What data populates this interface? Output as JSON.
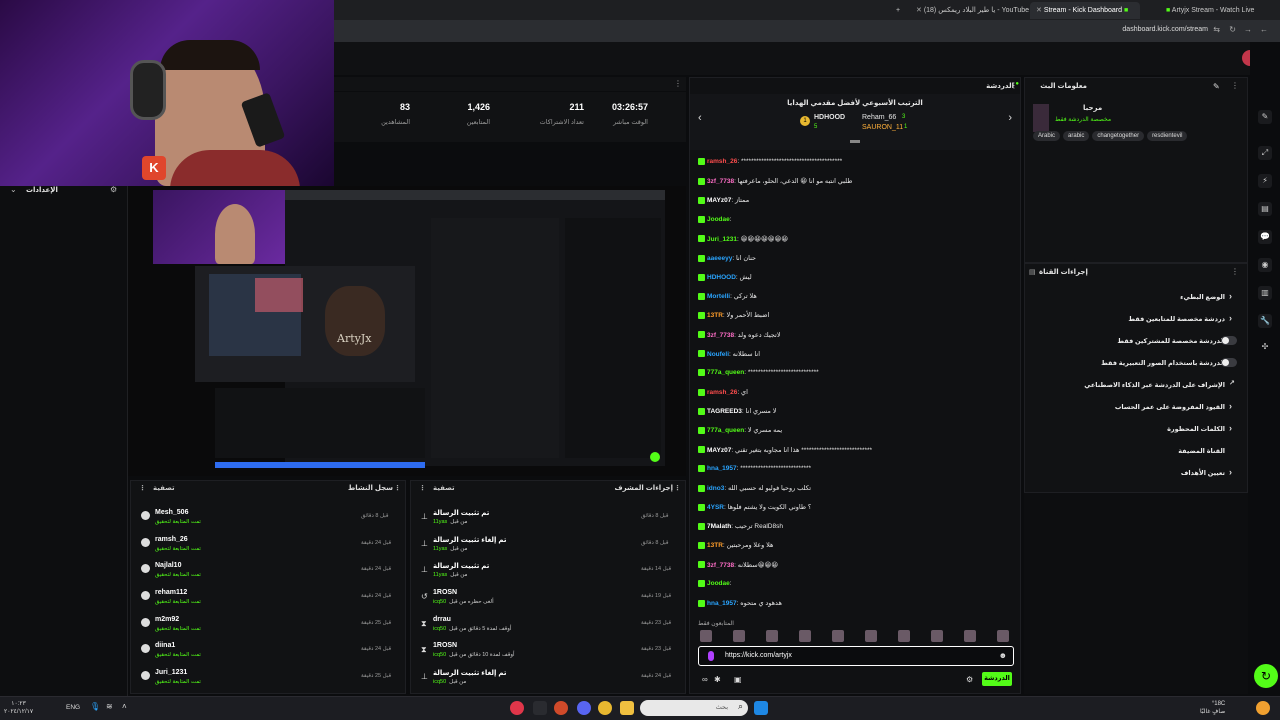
{
  "browser": {
    "tabs": [
      {
        "label": "Artyjx Stream - Watch Live"
      },
      {
        "label": "Stream - Kick Dashboard"
      },
      {
        "label": "(18) يا طير البلاد ريمكس - YouTube"
      }
    ],
    "url": "dashboard.kick.com/stream"
  },
  "left": {
    "title": "الإعدادات"
  },
  "webcam": {
    "logo": "K"
  },
  "stats": [
    {
      "value": "03:26:57",
      "label": "الوقت مباشر"
    },
    {
      "value": "211",
      "label": "تعداد الاشتراكات"
    },
    {
      "value": "1,426",
      "label": "المتابعين"
    },
    {
      "value": "83",
      "label": "المشاهدين"
    }
  ],
  "activity": {
    "title": "سجل النشاط",
    "filter": "تصفية",
    "rows": [
      {
        "name": "Mesh_506",
        "sub": "تمت المتابعة لتحقيق",
        "time": "قبل 8 دقائق"
      },
      {
        "name": "ramsh_26",
        "sub": "تمت المتابعة لتحقيق",
        "time": "قبل 24 دقيقة"
      },
      {
        "name": "Najlal10",
        "sub": "تمت المتابعة لتحقيق",
        "time": "قبل 24 دقيقة"
      },
      {
        "name": "reham112",
        "sub": "تمت المتابعة لتحقيق",
        "time": "قبل 24 دقيقة"
      },
      {
        "name": "m2m92",
        "sub": "تمت المتابعة لتحقيق",
        "time": "قبل 25 دقيقة"
      },
      {
        "name": "diina1",
        "sub": "تمت المتابعة لتحقيق",
        "time": "قبل 24 دقيقة"
      },
      {
        "name": "Juri_1231",
        "sub": "تمت المتابعة لتحقيق",
        "time": "قبل 25 دقيقة"
      }
    ]
  },
  "modlog": {
    "title": "إجراءات المشرف",
    "filter": "تصفية",
    "rows": [
      {
        "name": "تم تثبيت الرسالة",
        "by": "11yas",
        "sub": "من قبل",
        "time": "قبل 8 دقائق"
      },
      {
        "name": "تم إلغاء تثبيت الرسالة",
        "by": "11yas",
        "sub": "من قبل",
        "time": "قبل 8 دقائق"
      },
      {
        "name": "تم تثبيت الرسالة",
        "by": "11yas",
        "sub": "من قبل",
        "time": "قبل 14 دقيقة"
      },
      {
        "name": "1ROSN",
        "by": "icq50",
        "sub": "ألغى حظره من قبل",
        "time": "قبل 19 دقيقة"
      },
      {
        "name": "drrau",
        "by": "icq50",
        "sub": "أوقف لمدة 5 دقائق من قبل",
        "time": "قبل 23 دقيقة"
      },
      {
        "name": "1ROSN",
        "by": "icq50",
        "sub": "أوقف لمدة 10 دقائق من قبل",
        "time": "قبل 23 دقيقة"
      },
      {
        "name": "تم إلغاء تثبيت الرسالة",
        "by": "icq50",
        "sub": "من قبل",
        "time": "قبل 24 دقيقة"
      }
    ]
  },
  "chat": {
    "title": "الدردشة",
    "pinned_title": "الترتيب الأسبوعي لأفضل مقدمي الهدايا",
    "leaders": [
      {
        "rank": "1",
        "name": "HDHOOD",
        "count": "5"
      },
      {
        "rank": "3",
        "name": "Reham_66",
        "count": ""
      },
      {
        "rank": "1",
        "name": "SAURON_11",
        "count": "1"
      }
    ],
    "messages": [
      {
        "user": "ramsh_26",
        "color": "#ff4d4d",
        "text": ": ****************************************"
      },
      {
        "user": "3zf_7738",
        "color": "#ff6ec7",
        "text": ": طلبي انتبه مو انا 😀 الدعي، الحلو، ماعرفتها"
      },
      {
        "user": "MAYz07",
        "color": "#fff",
        "text": ": ممتاز"
      },
      {
        "user": "Joodae",
        "color": "#53fc18",
        "text": ":"
      },
      {
        "user": "Juri_1231",
        "color": "#53fc18",
        "text": ": 😀😀😀😀😀😀😀"
      },
      {
        "user": "aaeeeyy",
        "color": "#2aa5ff",
        "text": ": حنان انا"
      },
      {
        "user": "HDHOOD",
        "color": "#2aa5ff",
        "text": ": ليش"
      },
      {
        "user": "Mortelli",
        "color": "#2aa5ff",
        "text": ": هلا تركي"
      },
      {
        "user": "13TR",
        "color": "#ff9d2a",
        "text": ": اضبط الأحمر ولا"
      },
      {
        "user": "3zf_7738",
        "color": "#ff6ec7",
        "text": ": لاتجيك دعوه ولد"
      },
      {
        "user": "Noufeli",
        "color": "#2aa5ff",
        "text": ": انا سطلانه"
      },
      {
        "user": "777a_queen",
        "color": "#53fc18",
        "text": ": ****************************"
      },
      {
        "user": "ramsh_26",
        "color": "#ff4d4d",
        "text": ": اي"
      },
      {
        "user": "TAGREED3",
        "color": "#fff",
        "text": ": لا مسري انا"
      },
      {
        "user": "777a_queen",
        "color": "#53fc18",
        "text": ": يمه مسري لا"
      },
      {
        "user": "MAYz07",
        "color": "#fff",
        "text": ": هذا انا مجاوبه بتغير تقني ****************************"
      },
      {
        "user": "hna_1957",
        "color": "#2aa5ff",
        "text": ": ****************************"
      },
      {
        "user": "idno3",
        "color": "#2aa5ff",
        "text": ": تكلب روحيا فوليو له حسبي الله"
      },
      {
        "user": "4YSR",
        "color": "#2aa5ff",
        "text": ": ؟ طاوني الكويت ولا يشتم فلوها"
      },
      {
        "user": "7Malath",
        "color": "#fff",
        "text": ": ترحيب RealD8sh"
      },
      {
        "user": "13TR",
        "color": "#ff9d2a",
        "text": ": هلا وعلا ومرحبتين"
      },
      {
        "user": "3zf_7738",
        "color": "#ff6ec7",
        "text": ": سطلانه😀😀😀"
      },
      {
        "user": "Joodae",
        "color": "#53fc18",
        "text": ":"
      },
      {
        "user": "hna_1957",
        "color": "#2aa5ff",
        "text": ": هدهود ي متحوه"
      }
    ],
    "input_value": "https://kick.com/artyjx",
    "send_label": "الدردشة",
    "viewers_label": "المتابعون فقط"
  },
  "info": {
    "title": "معلومات البث",
    "stream_title": "مرحبا",
    "sub": "مخصصة الدردشة فقط",
    "tags": [
      "Arabic",
      "arabic",
      "changetogether",
      "resdientevil"
    ]
  },
  "mod_actions": {
    "title": "إجراءات القناة",
    "rows": [
      {
        "label": "الوضع البطيء",
        "type": "chevron"
      },
      {
        "label": "دردشة مخصصة للمتابعين فقط",
        "type": "chevron"
      },
      {
        "label": "الدردشة مخصصة للمشتركين فقط",
        "type": "toggle"
      },
      {
        "label": "الدردشة باستخدام الصور التعبيرية فقط",
        "type": "toggle"
      },
      {
        "label": "الإشراف على الدردشة عبر الذكاء الاصطناعي",
        "type": "link"
      },
      {
        "label": "القيود المفروضة على عمر الحساب",
        "type": "chevron"
      },
      {
        "label": "الكلمات المحظورة",
        "type": "chevron"
      },
      {
        "label": "القناة المضيفة",
        "type": "none"
      },
      {
        "label": "تعيين الأهداف",
        "type": "chevron"
      }
    ]
  },
  "taskbar": {
    "search": "بحث",
    "lang": "ENG",
    "time": "١٠:٢٣",
    "date": "٢٠٢٤/١٢/١٧",
    "weather": "°18C",
    "weather_sub": "صافٍ غالبًا"
  },
  "colors": {
    "accent": "#53fc18",
    "bg": "#0b0c0e",
    "panel": "#111214"
  }
}
